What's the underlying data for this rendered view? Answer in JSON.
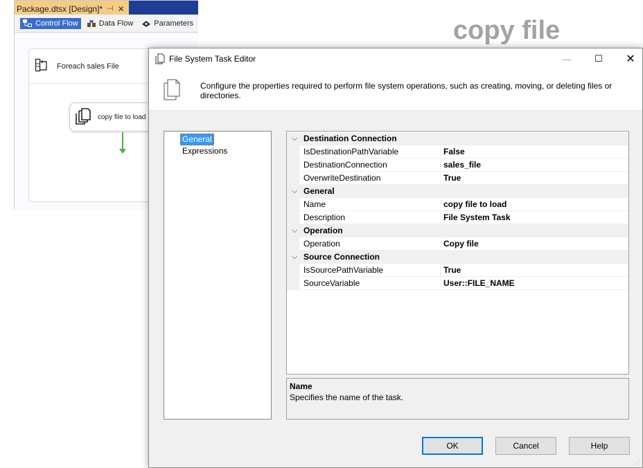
{
  "overlay": {
    "title": "copy file"
  },
  "ssis": {
    "tab_title": "Package.dtsx [Design]*",
    "tab_pin": "⊣",
    "tab_close": "✕",
    "toolbar": [
      {
        "label": "Control Flow",
        "icon": "control-flow-icon",
        "active": true
      },
      {
        "label": "Data Flow",
        "icon": "data-flow-icon",
        "active": false
      },
      {
        "label": "Parameters",
        "icon": "parameters-icon",
        "active": false
      }
    ],
    "foreach_label": "Foreach sales File",
    "task_label": "copy file to load"
  },
  "dialog": {
    "title": "File System Task Editor",
    "header_text": "Configure the properties required to perform file system operations, such as creating, moving, or deleting files or directories.",
    "nav": [
      {
        "label": "General",
        "selected": true
      },
      {
        "label": "Expressions",
        "selected": false
      }
    ],
    "properties": [
      {
        "category": "Destination Connection",
        "rows": [
          {
            "name": "IsDestinationPathVariable",
            "value": "False"
          },
          {
            "name": "DestinationConnection",
            "value": "sales_file"
          },
          {
            "name": "OverwriteDestination",
            "value": "True"
          }
        ]
      },
      {
        "category": "General",
        "rows": [
          {
            "name": "Name",
            "value": "copy file to load"
          },
          {
            "name": "Description",
            "value": "File System Task"
          }
        ]
      },
      {
        "category": "Operation",
        "rows": [
          {
            "name": "Operation",
            "value": "Copy file"
          }
        ]
      },
      {
        "category": "Source Connection",
        "rows": [
          {
            "name": "IsSourcePathVariable",
            "value": "True"
          },
          {
            "name": "SourceVariable",
            "value": "User::FILE_NAME"
          }
        ]
      }
    ],
    "description": {
      "title": "Name",
      "text": "Specifies the name of the task."
    },
    "buttons": {
      "ok": "OK",
      "cancel": "Cancel",
      "help": "Help"
    },
    "window_controls": {
      "minimize": "—",
      "maximize": "☐",
      "close": "✕"
    }
  },
  "colors": {
    "accent_selected": "#3399ff",
    "ok_border": "#0078d7",
    "ssis_tab_active": "#f5cc84",
    "ssis_header": "#1c3e94",
    "connector_green": "#4caf50",
    "overlay_gray": "#a3a3a3"
  }
}
